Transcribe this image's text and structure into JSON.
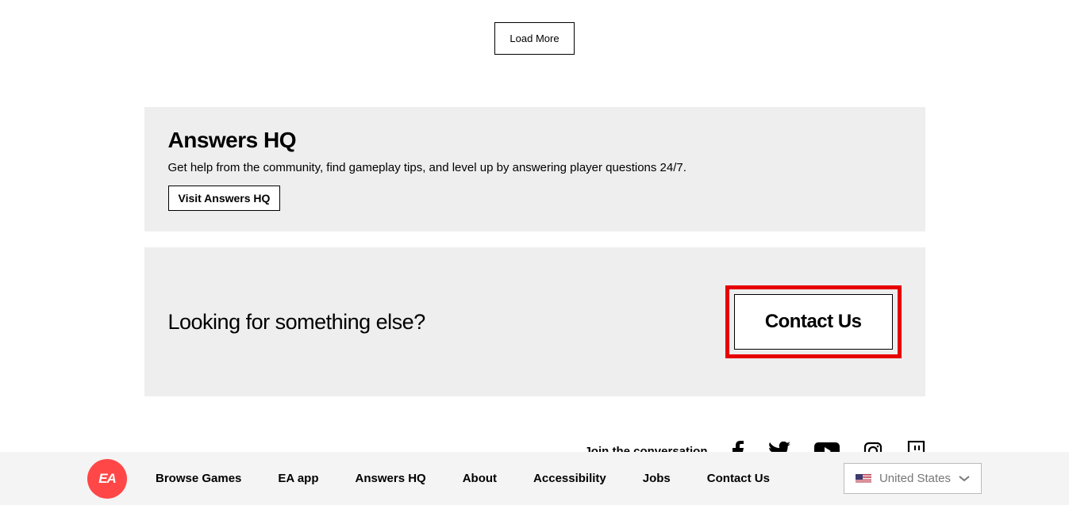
{
  "loadmore_label": "Load More",
  "answers": {
    "title": "Answers HQ",
    "desc": "Get help from the community, find gameplay tips, and level up by answering player questions 24/7.",
    "button": "Visit Answers HQ"
  },
  "contact": {
    "question": "Looking for something else?",
    "button": "Contact Us"
  },
  "social_label": "Join the conversation",
  "footer_nav": {
    "browse": "Browse Games",
    "eaapp": "EA app",
    "answershq": "Answers HQ",
    "about": "About",
    "accessibility": "Accessibility",
    "jobs": "Jobs",
    "contact": "Contact Us"
  },
  "region_label": "United States",
  "ea_logo_text": "EA"
}
